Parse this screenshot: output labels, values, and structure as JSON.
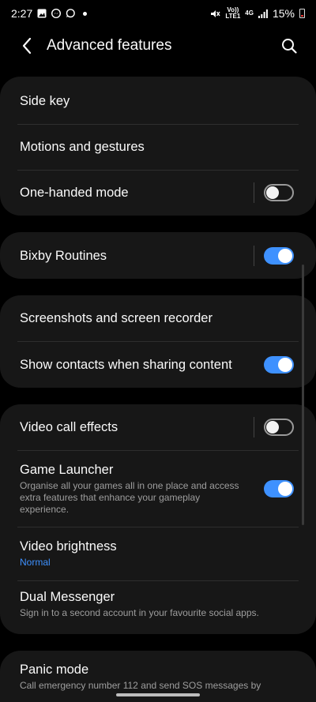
{
  "status_bar": {
    "time": "2:27",
    "battery_percent": "15%",
    "network_top": "Vo))",
    "network_bottom": "LTE1",
    "data_label": "4G",
    "icons": [
      "gallery-icon",
      "messenger-icon",
      "whatsapp-icon",
      "dot-icon",
      "mute-icon",
      "volte-icon",
      "signal-icon",
      "battery-icon"
    ]
  },
  "header": {
    "title": "Advanced features",
    "back_icon": "back-arrow-icon",
    "search_icon": "search-icon"
  },
  "groups": [
    {
      "items": [
        {
          "title": "Side key"
        },
        {
          "title": "Motions and gestures"
        },
        {
          "title": "One-handed mode",
          "toggle": false
        }
      ]
    },
    {
      "items": [
        {
          "title": "Bixby Routines",
          "toggle": true
        }
      ]
    },
    {
      "items": [
        {
          "title": "Screenshots and screen recorder"
        },
        {
          "title": "Show contacts when sharing content",
          "toggle": true
        }
      ]
    },
    {
      "items": [
        {
          "title": "Video call effects",
          "toggle": false
        },
        {
          "title": "Game Launcher",
          "subtitle": "Organise all your games all in one place and access extra features that enhance your gameplay experience.",
          "toggle": true
        },
        {
          "title": "Video brightness",
          "subtitle": "Normal"
        },
        {
          "title": "Dual Messenger",
          "subtitle": "Sign in to a second account in your favourite social apps."
        }
      ]
    },
    {
      "items": [
        {
          "title": "Panic mode",
          "subtitle": "Call emergency number 112 and send SOS messages by"
        }
      ]
    }
  ],
  "colors": {
    "accent": "#3e91ff",
    "card": "#171717",
    "background": "#000000"
  }
}
